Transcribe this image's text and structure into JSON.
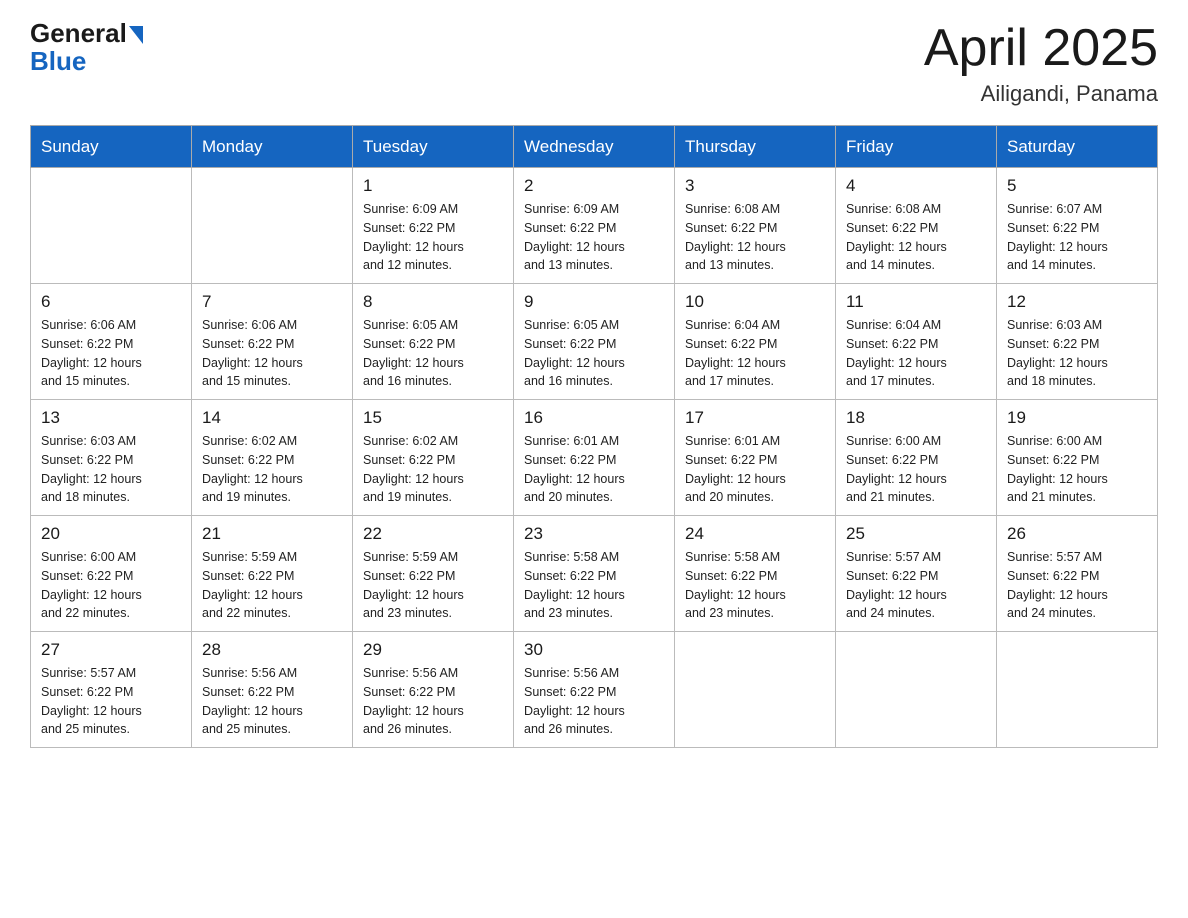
{
  "header": {
    "logo_general": "General",
    "logo_blue": "Blue",
    "month_year": "April 2025",
    "location": "Ailigandi, Panama"
  },
  "days_of_week": [
    "Sunday",
    "Monday",
    "Tuesday",
    "Wednesday",
    "Thursday",
    "Friday",
    "Saturday"
  ],
  "weeks": [
    [
      {
        "day": "",
        "info": ""
      },
      {
        "day": "",
        "info": ""
      },
      {
        "day": "1",
        "info": "Sunrise: 6:09 AM\nSunset: 6:22 PM\nDaylight: 12 hours\nand 12 minutes."
      },
      {
        "day": "2",
        "info": "Sunrise: 6:09 AM\nSunset: 6:22 PM\nDaylight: 12 hours\nand 13 minutes."
      },
      {
        "day": "3",
        "info": "Sunrise: 6:08 AM\nSunset: 6:22 PM\nDaylight: 12 hours\nand 13 minutes."
      },
      {
        "day": "4",
        "info": "Sunrise: 6:08 AM\nSunset: 6:22 PM\nDaylight: 12 hours\nand 14 minutes."
      },
      {
        "day": "5",
        "info": "Sunrise: 6:07 AM\nSunset: 6:22 PM\nDaylight: 12 hours\nand 14 minutes."
      }
    ],
    [
      {
        "day": "6",
        "info": "Sunrise: 6:06 AM\nSunset: 6:22 PM\nDaylight: 12 hours\nand 15 minutes."
      },
      {
        "day": "7",
        "info": "Sunrise: 6:06 AM\nSunset: 6:22 PM\nDaylight: 12 hours\nand 15 minutes."
      },
      {
        "day": "8",
        "info": "Sunrise: 6:05 AM\nSunset: 6:22 PM\nDaylight: 12 hours\nand 16 minutes."
      },
      {
        "day": "9",
        "info": "Sunrise: 6:05 AM\nSunset: 6:22 PM\nDaylight: 12 hours\nand 16 minutes."
      },
      {
        "day": "10",
        "info": "Sunrise: 6:04 AM\nSunset: 6:22 PM\nDaylight: 12 hours\nand 17 minutes."
      },
      {
        "day": "11",
        "info": "Sunrise: 6:04 AM\nSunset: 6:22 PM\nDaylight: 12 hours\nand 17 minutes."
      },
      {
        "day": "12",
        "info": "Sunrise: 6:03 AM\nSunset: 6:22 PM\nDaylight: 12 hours\nand 18 minutes."
      }
    ],
    [
      {
        "day": "13",
        "info": "Sunrise: 6:03 AM\nSunset: 6:22 PM\nDaylight: 12 hours\nand 18 minutes."
      },
      {
        "day": "14",
        "info": "Sunrise: 6:02 AM\nSunset: 6:22 PM\nDaylight: 12 hours\nand 19 minutes."
      },
      {
        "day": "15",
        "info": "Sunrise: 6:02 AM\nSunset: 6:22 PM\nDaylight: 12 hours\nand 19 minutes."
      },
      {
        "day": "16",
        "info": "Sunrise: 6:01 AM\nSunset: 6:22 PM\nDaylight: 12 hours\nand 20 minutes."
      },
      {
        "day": "17",
        "info": "Sunrise: 6:01 AM\nSunset: 6:22 PM\nDaylight: 12 hours\nand 20 minutes."
      },
      {
        "day": "18",
        "info": "Sunrise: 6:00 AM\nSunset: 6:22 PM\nDaylight: 12 hours\nand 21 minutes."
      },
      {
        "day": "19",
        "info": "Sunrise: 6:00 AM\nSunset: 6:22 PM\nDaylight: 12 hours\nand 21 minutes."
      }
    ],
    [
      {
        "day": "20",
        "info": "Sunrise: 6:00 AM\nSunset: 6:22 PM\nDaylight: 12 hours\nand 22 minutes."
      },
      {
        "day": "21",
        "info": "Sunrise: 5:59 AM\nSunset: 6:22 PM\nDaylight: 12 hours\nand 22 minutes."
      },
      {
        "day": "22",
        "info": "Sunrise: 5:59 AM\nSunset: 6:22 PM\nDaylight: 12 hours\nand 23 minutes."
      },
      {
        "day": "23",
        "info": "Sunrise: 5:58 AM\nSunset: 6:22 PM\nDaylight: 12 hours\nand 23 minutes."
      },
      {
        "day": "24",
        "info": "Sunrise: 5:58 AM\nSunset: 6:22 PM\nDaylight: 12 hours\nand 23 minutes."
      },
      {
        "day": "25",
        "info": "Sunrise: 5:57 AM\nSunset: 6:22 PM\nDaylight: 12 hours\nand 24 minutes."
      },
      {
        "day": "26",
        "info": "Sunrise: 5:57 AM\nSunset: 6:22 PM\nDaylight: 12 hours\nand 24 minutes."
      }
    ],
    [
      {
        "day": "27",
        "info": "Sunrise: 5:57 AM\nSunset: 6:22 PM\nDaylight: 12 hours\nand 25 minutes."
      },
      {
        "day": "28",
        "info": "Sunrise: 5:56 AM\nSunset: 6:22 PM\nDaylight: 12 hours\nand 25 minutes."
      },
      {
        "day": "29",
        "info": "Sunrise: 5:56 AM\nSunset: 6:22 PM\nDaylight: 12 hours\nand 26 minutes."
      },
      {
        "day": "30",
        "info": "Sunrise: 5:56 AM\nSunset: 6:22 PM\nDaylight: 12 hours\nand 26 minutes."
      },
      {
        "day": "",
        "info": ""
      },
      {
        "day": "",
        "info": ""
      },
      {
        "day": "",
        "info": ""
      }
    ]
  ]
}
